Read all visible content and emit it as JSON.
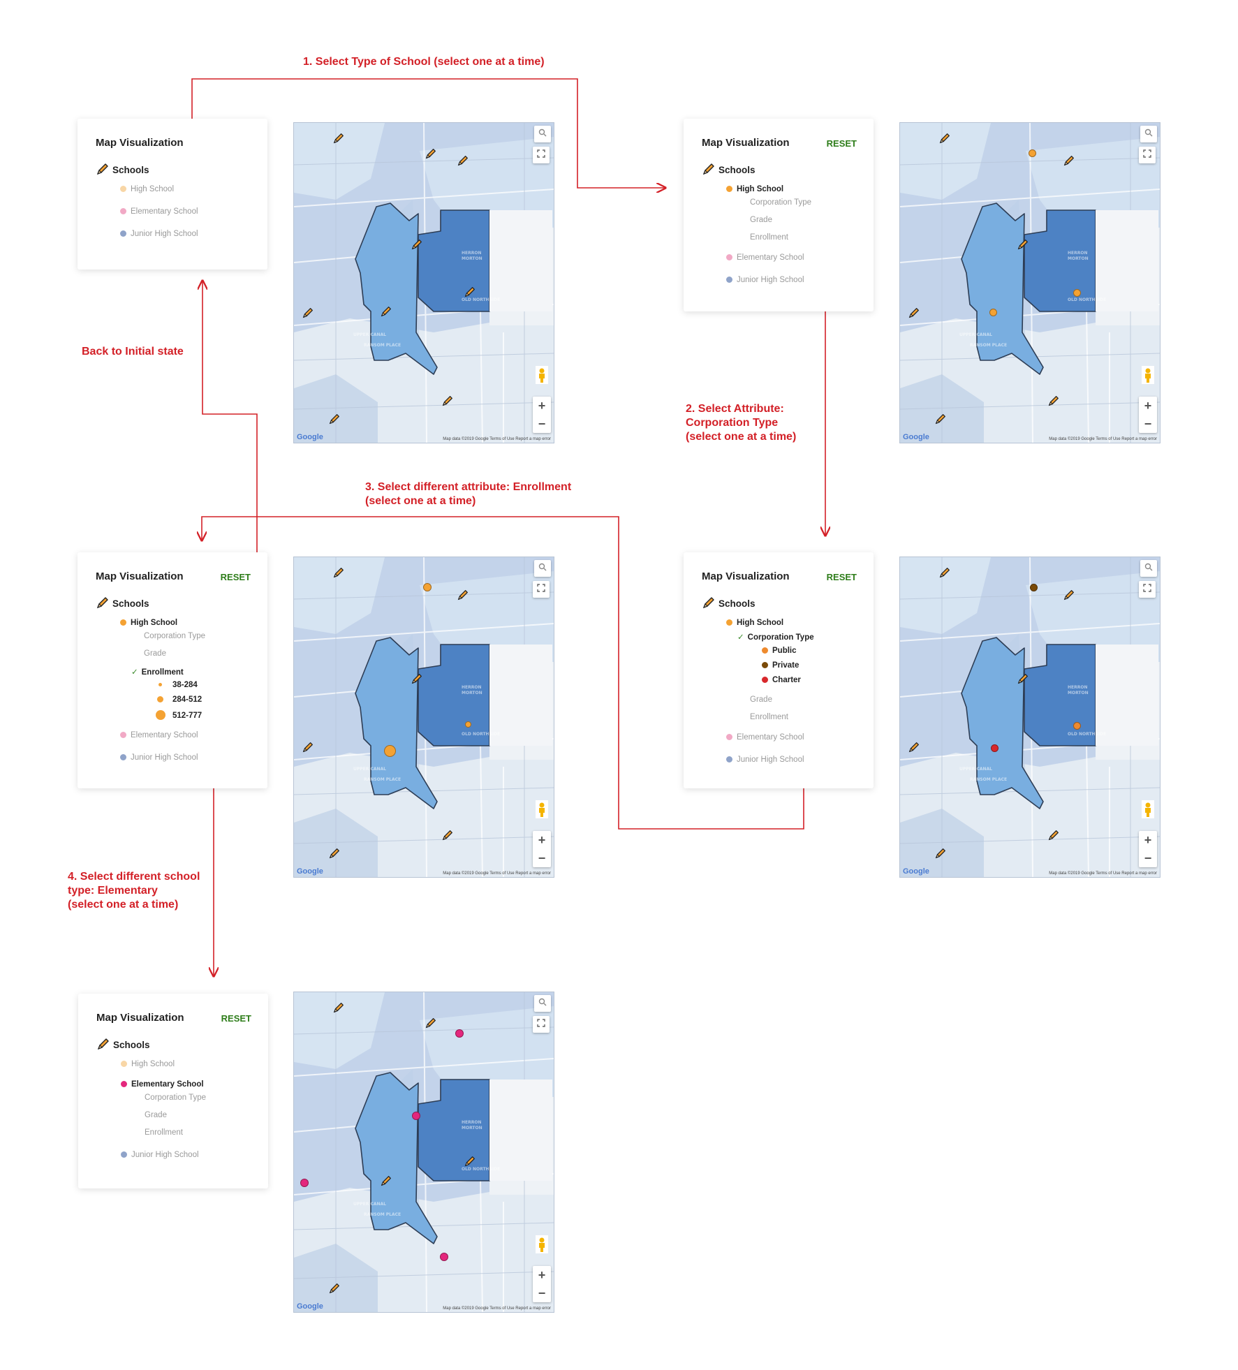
{
  "annotations": {
    "step1": "1. Select Type of School (select one at a time)",
    "back": "Back to Initial state",
    "step2_line1": "2. Select Attribute:",
    "step2_line2": "Corporation Type",
    "step2_line3": "(select one at a time)",
    "step3_line1": "3. Select different attribute: Enrollment",
    "step3_line2": "(select one at a time)",
    "step4_line1": "4. Select different school",
    "step4_line2": "type: Elementary",
    "step4_line3": "(select one at a time)"
  },
  "panel": {
    "title": "Map Visualization",
    "reset": "RESET",
    "schools": "Schools",
    "high_school": "High School",
    "elementary": "Elementary School",
    "junior": "Junior High School",
    "corp_type": "Corporation Type",
    "grade": "Grade",
    "enrollment": "Enrollment",
    "public": "Public",
    "private": "Private",
    "charter": "Charter",
    "enroll_r1": "38-284",
    "enroll_r2": "284-512",
    "enroll_r3": "512-777"
  },
  "map": {
    "google": "Google",
    "mapdata": "Map data ©2019 Google   Terms of Use   Report a map error",
    "zoom_in": "+",
    "zoom_out": "−",
    "fullscreen": "⛶",
    "search": "🔍"
  },
  "colors": {
    "annotation": "#d32027",
    "reset": "#2e7d1a",
    "high_school": "#f4a233",
    "high_school_faded": "#f8d6a6",
    "elementary": "#e4277d",
    "elementary_faded": "#f1a9c5",
    "junior": "#8fa3c9",
    "public": "#ee8a2e",
    "private": "#7a4a07",
    "charter": "#d8282c",
    "district_dark": "#4d82c4",
    "district_light": "#79aee0"
  }
}
